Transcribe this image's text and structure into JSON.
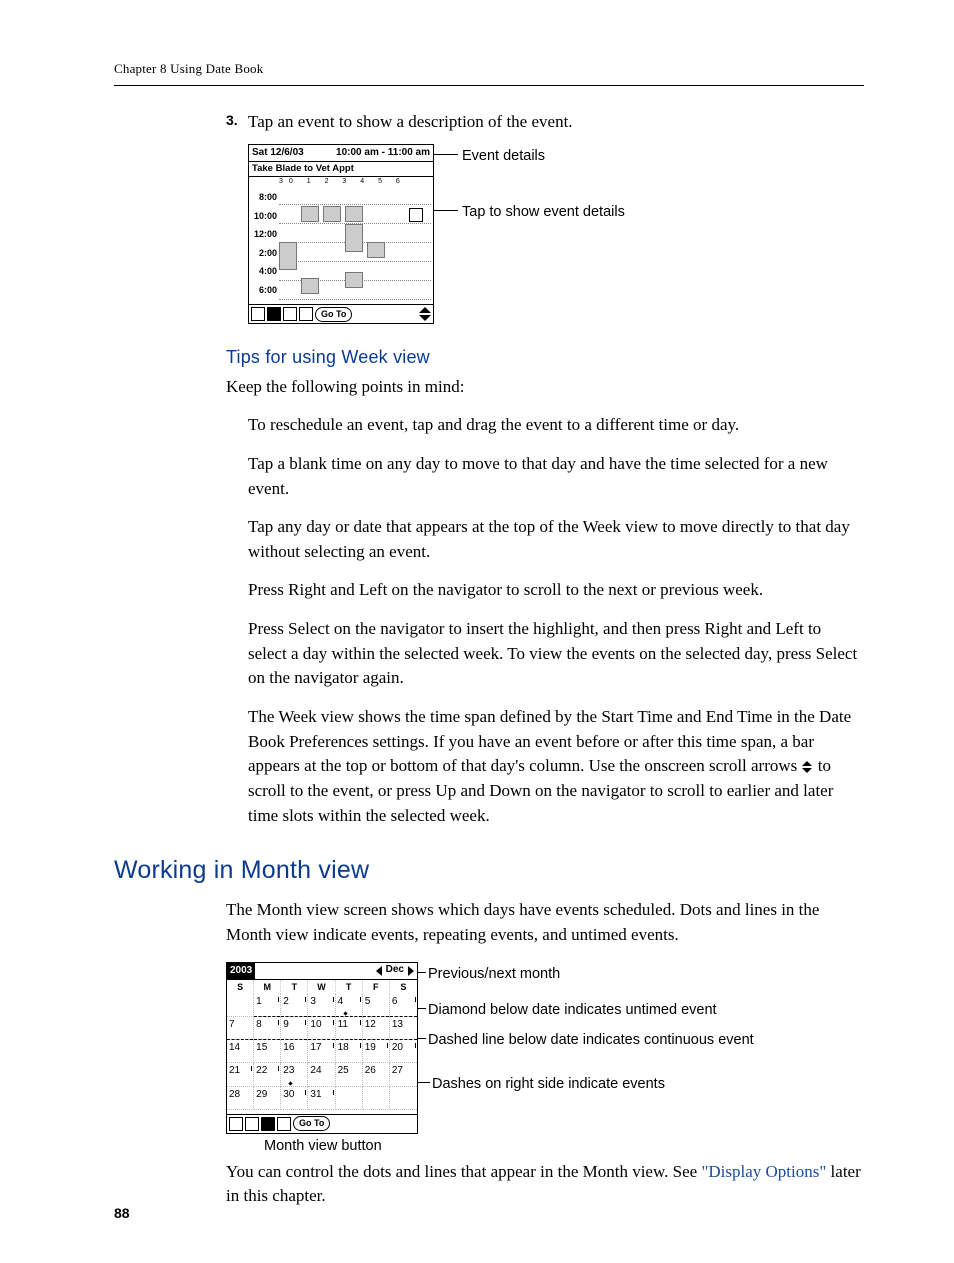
{
  "running_head": "Chapter 8   Using Date Book",
  "page_number": "88",
  "step": {
    "number": "3.",
    "text": "Tap an event to show a description of the event."
  },
  "fig1": {
    "head_left": "Sat 12/6/03",
    "head_right": "10:00 am - 11:00 am",
    "subtitle": "Take Blade to Vet Appt",
    "days_strip": "30  1  2  3  4  5  6",
    "times": [
      "8:00",
      "10:00",
      "12:00",
      "2:00",
      "4:00",
      "6:00"
    ],
    "goto": "Go To",
    "callout_event_details": "Event details",
    "callout_tap": "Tap to show event details"
  },
  "h3_tips": "Tips for using Week view",
  "tips_intro": "Keep the following points in mind:",
  "tips": [
    "To reschedule an event, tap and drag the event to a different time or day.",
    "Tap a blank time on any day to move to that day and have the time selected for a new event.",
    "Tap any day or date that appears at the top of the Week view to move directly to that day without selecting an event.",
    "Press Right and Left on the navigator to scroll to the next or previous week.",
    "Press Select on the navigator to insert the highlight, and then press Right and Left to select a day within the selected week. To view the events on the selected day, press Select on the navigator again."
  ],
  "week_note_a": "The Week view shows the time span defined by the Start Time and End Time in the Date Book Preferences settings. If you have an event before or after this time span, a bar appears at the top or bottom of that day's column. Use the onscreen scroll arrows ",
  "week_note_b": " to scroll to the event, or press Up and Down on the navigator to scroll to earlier and later time slots within the selected week.",
  "h2_month": "Working in Month view",
  "month_intro": "The Month view screen shows which days have events scheduled. Dots and lines in the Month view indicate events, repeating events, and untimed events.",
  "fig2": {
    "year": "2003",
    "month": "Dec",
    "dow": [
      "S",
      "M",
      "T",
      "W",
      "T",
      "F",
      "S"
    ],
    "goto": "Go To",
    "caption": "Month view button",
    "callouts": {
      "prevnext": "Previous/next month",
      "diamond": "Diamond below date indicates untimed event",
      "dashed": "Dashed line below date indicates continuous event",
      "dashes_right": "Dashes on right side indicate events"
    }
  },
  "chart_data": {
    "type": "table",
    "title": "Month View Calendar — Dec 2003",
    "columns": [
      "S",
      "M",
      "T",
      "W",
      "T",
      "F",
      "S"
    ],
    "rows": [
      [
        "",
        "1",
        "2",
        "3",
        "4",
        "5",
        "6"
      ],
      [
        "7",
        "8",
        "9",
        "10",
        "11",
        "12",
        "13"
      ],
      [
        "14",
        "15",
        "16",
        "17",
        "18",
        "19",
        "20"
      ],
      [
        "21",
        "22",
        "23",
        "24",
        "25",
        "26",
        "27"
      ],
      [
        "28",
        "29",
        "30",
        "31",
        "",
        "",
        ""
      ]
    ]
  },
  "month_outro_a": "You can control the dots and lines that appear in the Month view. See ",
  "month_link": "\"Display Options\"",
  "month_outro_b": " later in this chapter."
}
